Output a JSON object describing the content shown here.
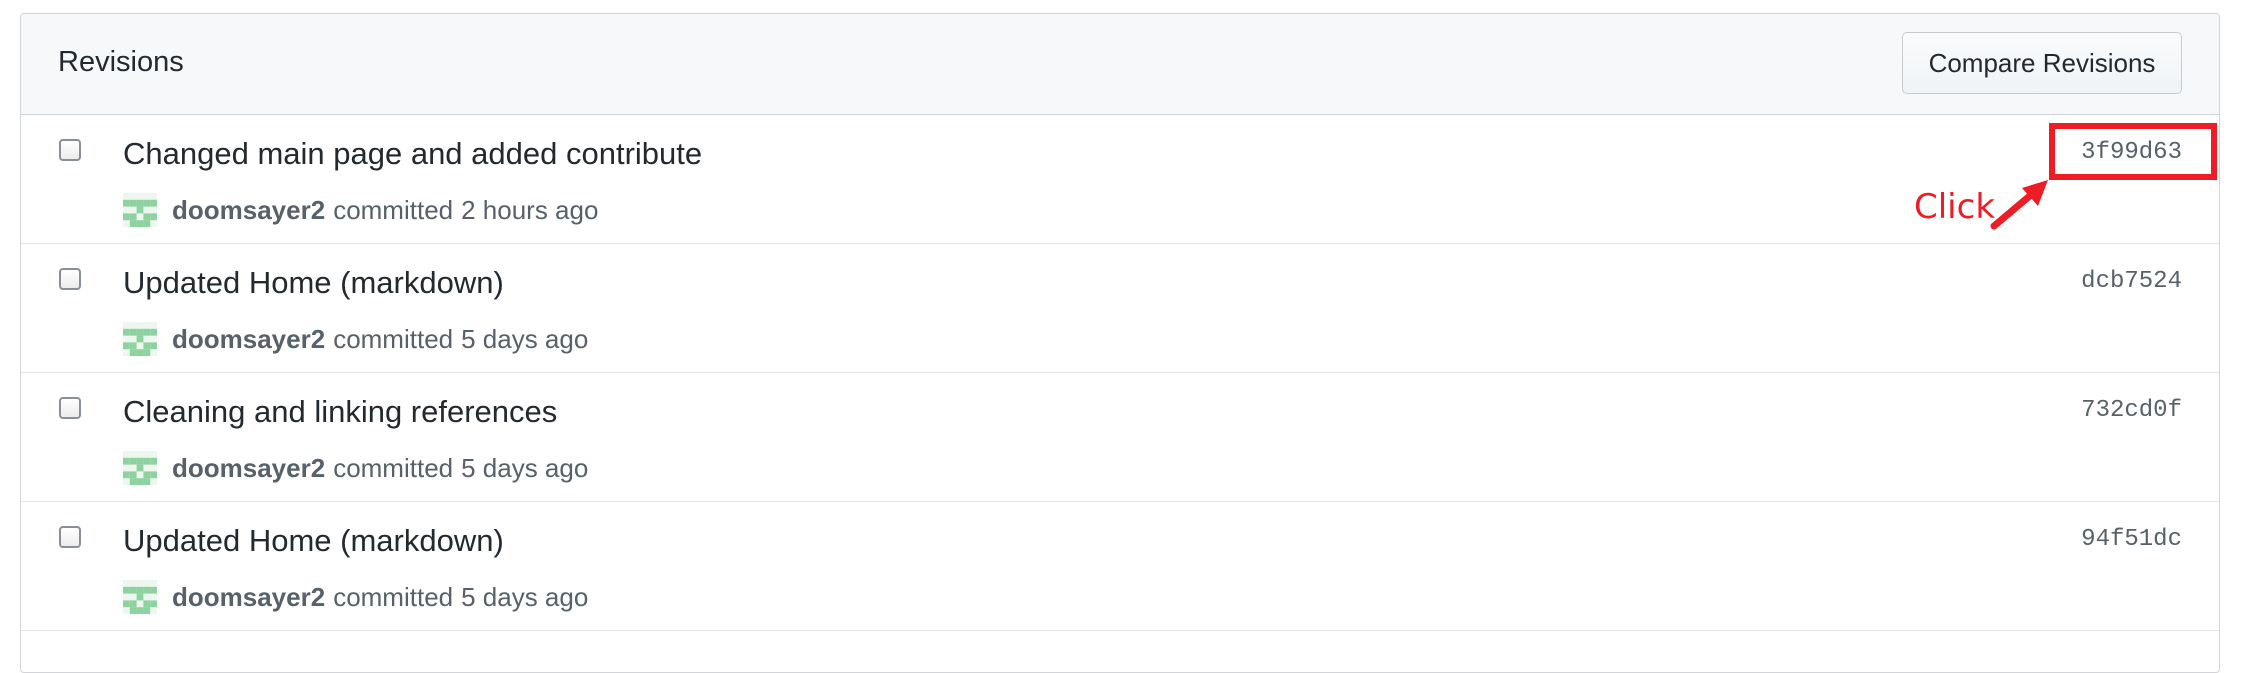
{
  "panel": {
    "title": "Revisions",
    "compare_button_label": "Compare Revisions"
  },
  "commits": [
    {
      "message": "Changed main page and added contribute",
      "author": "doomsayer2",
      "committed_label": "committed",
      "time": "2 hours ago",
      "sha": "3f99d63"
    },
    {
      "message": "Updated Home (markdown)",
      "author": "doomsayer2",
      "committed_label": "committed",
      "time": "5 days ago",
      "sha": "dcb7524"
    },
    {
      "message": "Cleaning and linking references",
      "author": "doomsayer2",
      "committed_label": "committed",
      "time": "5 days ago",
      "sha": "732cd0f"
    },
    {
      "message": "Updated Home (markdown)",
      "author": "doomsayer2",
      "committed_label": "committed",
      "time": "5 days ago",
      "sha": "94f51dc"
    }
  ],
  "annotation": {
    "text": "Click",
    "color": "#ee1c25"
  },
  "colors": {
    "avatar_green": "#8ed2a0",
    "header_bg": "#f6f8fa",
    "border": "#d1d5da"
  },
  "icons": {
    "avatar": "identicon-avatar",
    "arrow": "arrow-up-right-icon"
  }
}
